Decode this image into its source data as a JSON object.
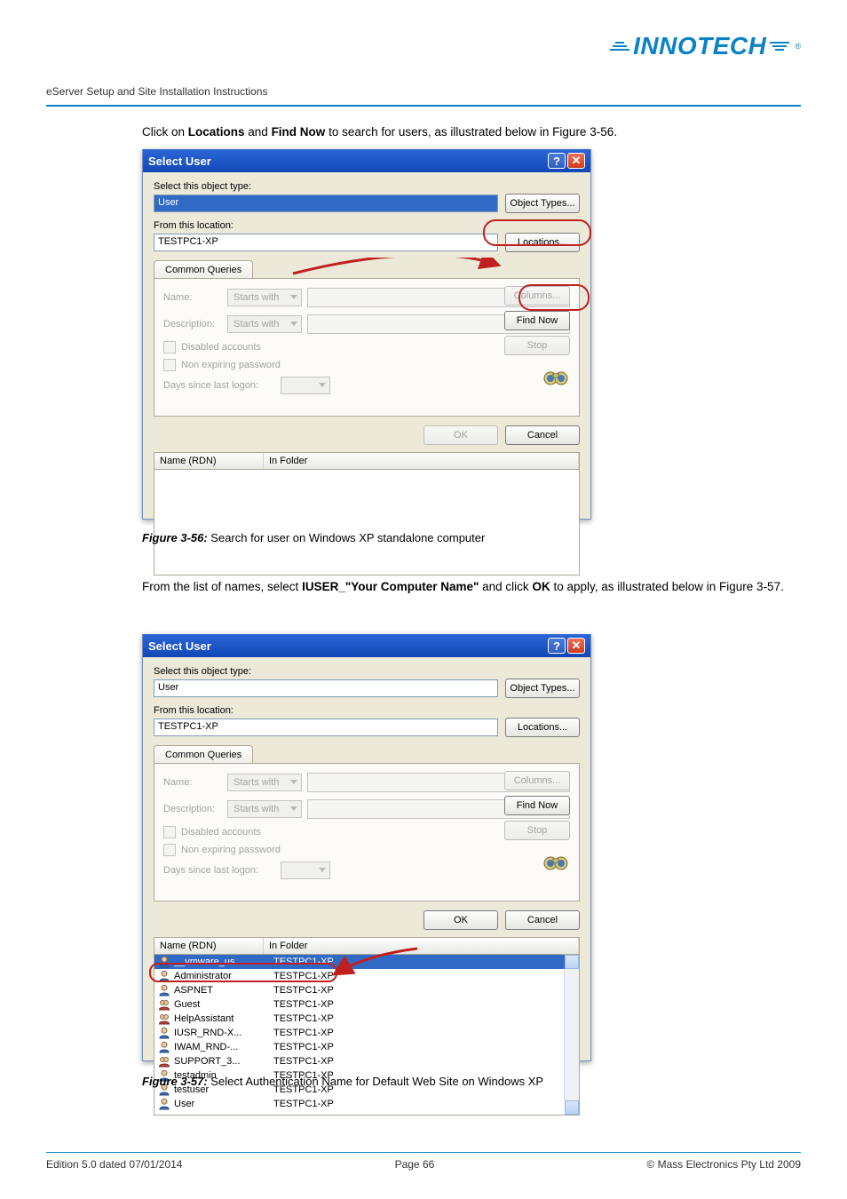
{
  "header": {
    "logo_text": "INNOTECH",
    "doc_title": "eServer Setup and Site Installation Instructions"
  },
  "body": {
    "para1_pre": "Click on ",
    "para1_b1": "Locations",
    "para1_mid": " and ",
    "para1_b2": "Find Now",
    "para1_post": " to search for users, as illustrated below in Figure 3-56.",
    "para2_pre": "From the list of names, select  ",
    "para2_b1": "IUSER_\"Your Computer Name\"",
    "para2_mid": " and click ",
    "para2_b2": "OK",
    "para2_post": " to apply, as illustrated below in Figure 3-57."
  },
  "captions": {
    "fig56_b": "Figure 3-56:",
    "fig56_t": "   Search for user on Windows XP standalone computer",
    "fig57_b": "Figure 3-57:",
    "fig57_t": "   Select Authentication Name for Default Web Site on Windows XP"
  },
  "dlg": {
    "title": "Select User",
    "lbl_type": "Select this object type:",
    "val_type": "User",
    "btn_types": "Object Types...",
    "lbl_loc": "From this location:",
    "val_loc": "TESTPC1-XP",
    "btn_loc": "Locations...",
    "tab_common": "Common Queries",
    "lbl_name": "Name:",
    "lbl_desc": "Description:",
    "dd_starts": "Starts with",
    "chk_disabled": "Disabled accounts",
    "chk_nonexp": "Non expiring password",
    "lbl_days": "Days since last logon:",
    "btn_cols": "Columns...",
    "btn_find": "Find Now",
    "btn_stop": "Stop",
    "btn_ok": "OK",
    "btn_cancel": "Cancel",
    "col_name": "Name (RDN)",
    "col_folder": "In Folder"
  },
  "results2": [
    {
      "name": "__vmware_us...",
      "folder": "TESTPC1-XP",
      "sel": true
    },
    {
      "name": "Administrator",
      "folder": "TESTPC1-XP"
    },
    {
      "name": "ASPNET",
      "folder": "TESTPC1-XP"
    },
    {
      "name": "Guest",
      "folder": "TESTPC1-XP"
    },
    {
      "name": "HelpAssistant",
      "folder": "TESTPC1-XP"
    },
    {
      "name": "IUSR_RND-X...",
      "folder": "TESTPC1-XP",
      "hl": true
    },
    {
      "name": "IWAM_RND-...",
      "folder": "TESTPC1-XP"
    },
    {
      "name": "SUPPORT_3...",
      "folder": "TESTPC1-XP"
    },
    {
      "name": "testadmin",
      "folder": "TESTPC1-XP"
    },
    {
      "name": "testuser",
      "folder": "TESTPC1-XP"
    },
    {
      "name": "User",
      "folder": "TESTPC1-XP"
    }
  ],
  "footer": {
    "left": "Edition 5.0 dated 07/01/2014",
    "center": "Page 66",
    "right": "© Mass Electronics Pty Ltd  2009"
  }
}
